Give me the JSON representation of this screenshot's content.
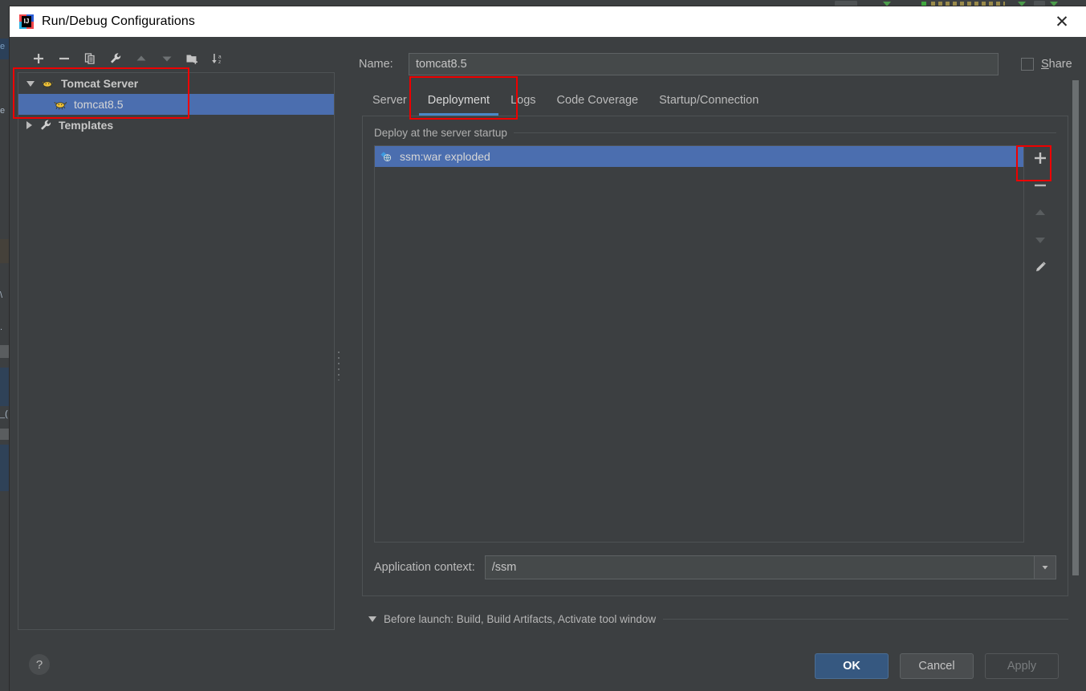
{
  "window": {
    "title": "Run/Debug Configurations",
    "app_icon": "intellij-idea-icon",
    "close_label": "✕"
  },
  "left_pane": {
    "toolbar": [
      {
        "name": "add-configuration-button",
        "icon": "plus-icon",
        "tooltip": "Add New Configuration"
      },
      {
        "name": "remove-configuration-button",
        "icon": "minus-icon",
        "tooltip": "Remove Configuration"
      },
      {
        "name": "copy-configuration-button",
        "icon": "copy-icon",
        "tooltip": "Copy Configuration"
      },
      {
        "name": "edit-defaults-button",
        "icon": "wrench-icon",
        "tooltip": "Edit Defaults"
      },
      {
        "name": "move-up-button",
        "icon": "arrow-up-icon",
        "tooltip": "Move Up"
      },
      {
        "name": "move-down-button",
        "icon": "arrow-down-icon",
        "tooltip": "Move Down"
      },
      {
        "name": "new-folder-button",
        "icon": "folder-add-icon",
        "tooltip": "Create New Folder"
      },
      {
        "name": "sort-button",
        "icon": "sort-az-icon",
        "tooltip": "Sort Configurations"
      }
    ],
    "tree": [
      {
        "label": "Tomcat Server",
        "icon": "tomcat-icon",
        "level": 0,
        "expanded": true,
        "selected": false
      },
      {
        "label": "tomcat8.5",
        "icon": "tomcat-icon",
        "level": 1,
        "expanded": null,
        "selected": true
      },
      {
        "label": "Templates",
        "icon": "wrench-icon",
        "level": 0,
        "expanded": false,
        "selected": false
      }
    ],
    "help_button_label": "?"
  },
  "right_pane": {
    "name_label": "Name:",
    "name_value": "tomcat8.5",
    "name_placeholder": "",
    "share": {
      "label": "Share",
      "mnemonic": "S",
      "checked": false
    },
    "tabs": [
      {
        "label": "Server",
        "active": false
      },
      {
        "label": "Deployment",
        "active": true
      },
      {
        "label": "Logs",
        "active": false
      },
      {
        "label": "Code Coverage",
        "active": false
      },
      {
        "label": "Startup/Connection",
        "active": false
      }
    ],
    "deployment": {
      "legend": "Deploy at the server startup",
      "items": [
        {
          "label": "ssm:war exploded",
          "icon": "artifact-icon",
          "selected": true
        }
      ],
      "actions": [
        {
          "name": "add-artifact-button",
          "icon": "plus-icon",
          "enabled": true
        },
        {
          "name": "remove-artifact-button",
          "icon": "minus-icon",
          "enabled": true
        },
        {
          "name": "move-up-button",
          "icon": "arrow-up-icon",
          "enabled": false
        },
        {
          "name": "move-down-button",
          "icon": "arrow-down-icon",
          "enabled": false
        },
        {
          "name": "edit-artifact-button",
          "icon": "pencil-icon",
          "enabled": true
        }
      ],
      "application_context_label": "Application context:",
      "application_context_value": "/ssm",
      "application_context_placeholder": ""
    },
    "before_launch": {
      "text": "Before launch: Build, Build Artifacts, Activate tool window",
      "expanded": true
    }
  },
  "buttons": {
    "ok": "OK",
    "cancel": "Cancel",
    "apply": "Apply"
  },
  "colors": {
    "dialog_bg": "#3c3f41",
    "selection_blue": "#4b6eaf",
    "tab_underline": "#4a88c7",
    "primary_button": "#365880",
    "annotation_red": "#ee0000",
    "titlebar_bg": "#ffffff"
  }
}
